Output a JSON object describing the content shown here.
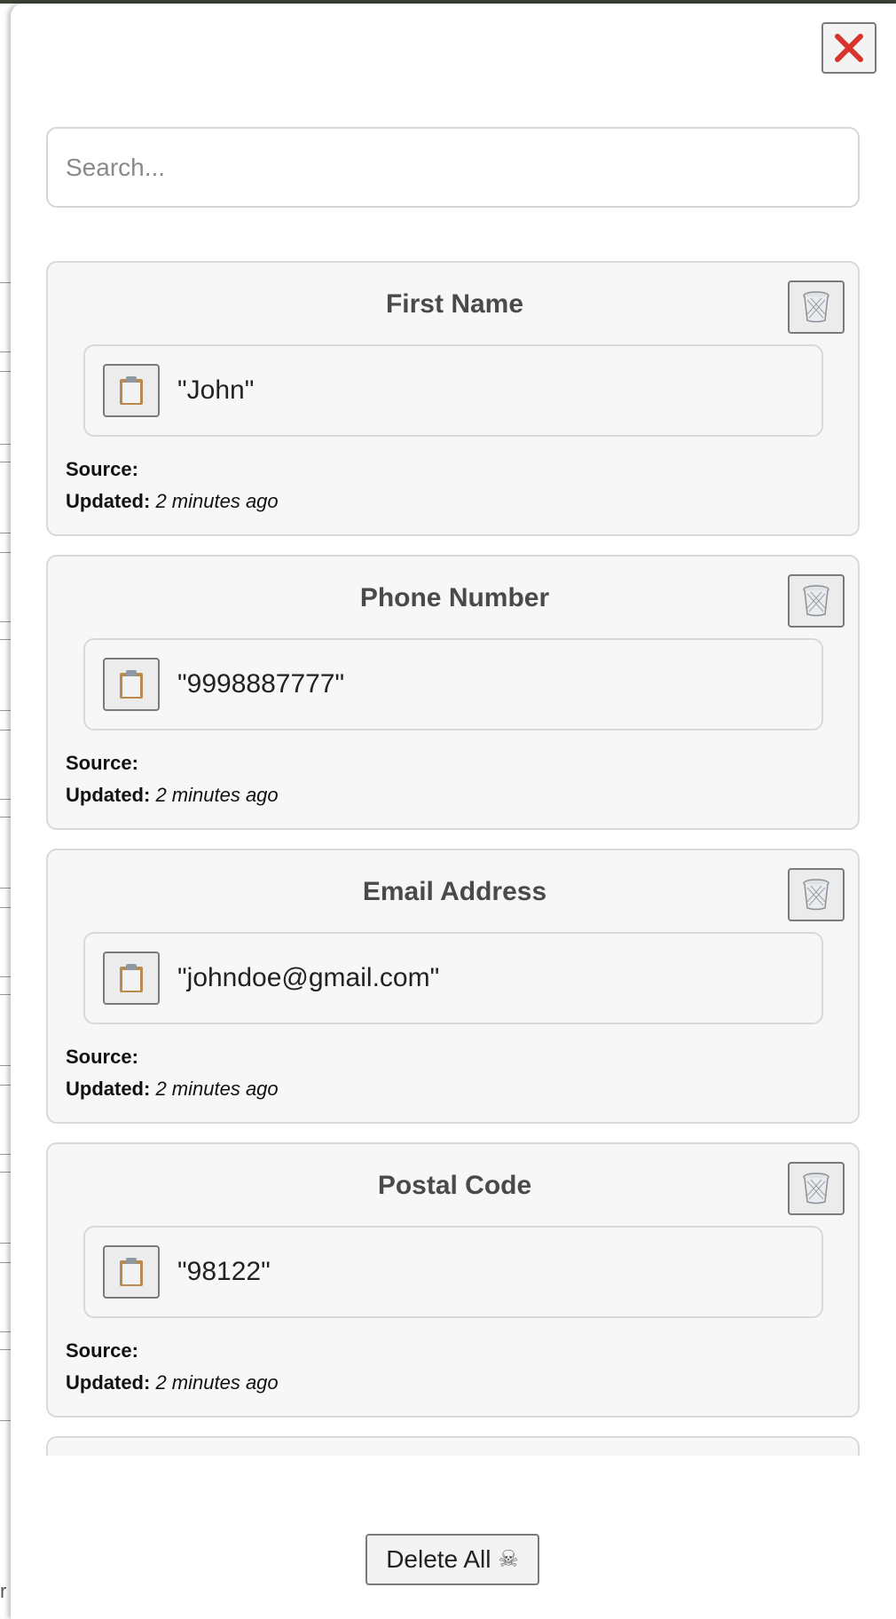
{
  "search": {
    "placeholder": "Search..."
  },
  "fields": [
    {
      "title": "First Name",
      "value": "\"John\"",
      "source_label": "Source:",
      "source_value": "",
      "updated_label": "Updated:",
      "updated_value": "2 minutes ago"
    },
    {
      "title": "Phone Number",
      "value": "\"9998887777\"",
      "source_label": "Source:",
      "source_value": "",
      "updated_label": "Updated:",
      "updated_value": "2 minutes ago"
    },
    {
      "title": "Email Address",
      "value": "\"johndoe@gmail.com\"",
      "source_label": "Source:",
      "source_value": "",
      "updated_label": "Updated:",
      "updated_value": "2 minutes ago"
    },
    {
      "title": "Postal Code",
      "value": "\"98122\"",
      "source_label": "Source:",
      "source_value": "",
      "updated_label": "Updated:",
      "updated_value": "2 minutes ago"
    }
  ],
  "footer": {
    "delete_all_label": "Delete All",
    "delete_all_icon": "☠"
  },
  "backdrop": {
    "edge_glyph": "r"
  },
  "icons": {
    "close": "close-icon",
    "trash": "trash-icon",
    "copy": "clipboard-icon",
    "skull": "skull-icon"
  },
  "colors": {
    "close_x": "#d9342b",
    "card_bg": "#f7f7f7",
    "card_border": "#d9d9d9",
    "title_text": "#4a4a4a"
  }
}
